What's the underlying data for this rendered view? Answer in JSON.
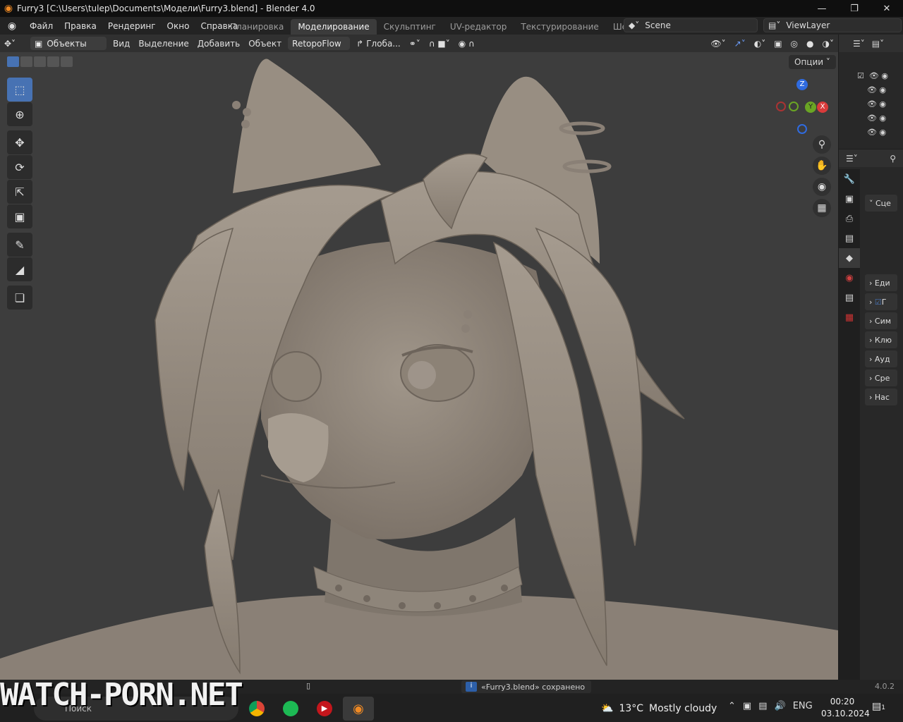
{
  "window": {
    "title": "Furry3 [C:\\Users\\tulep\\Documents\\Модели\\Furry3.blend] - Blender 4.0"
  },
  "menu": [
    "Файл",
    "Правка",
    "Рендеринг",
    "Окно",
    "Справка"
  ],
  "workspaces": [
    "Планировка",
    "Моделирование",
    "Скульптинг",
    "UV-редактор",
    "Текстурирование",
    "Шейдинг"
  ],
  "active_workspace": "Моделирование",
  "scene": {
    "name": "Scene"
  },
  "view_layer": {
    "name": "ViewLayer"
  },
  "viewport_header": {
    "mode": "Объекты",
    "items": [
      "Вид",
      "Выделение",
      "Добавить",
      "Объект"
    ],
    "addon": "RetopoFlow",
    "orientation": "Глоба...",
    "options": "Опции"
  },
  "toolbar_tools": [
    "select-box",
    "cursor",
    "move",
    "rotate",
    "scale",
    "transform",
    "annotate",
    "measure",
    "add-cube"
  ],
  "gizmo": {
    "x": "X",
    "y": "Y",
    "z": "Z"
  },
  "properties_panels": [
    "Сце",
    "Еди",
    "Г",
    "Сим",
    "Клю",
    "Ауд",
    "Сре",
    "Нас"
  ],
  "status": {
    "message": "«Furry3.blend» сохранено",
    "version": "4.0.2"
  },
  "taskbar": {
    "search": "Поиск",
    "weather_temp": "13°C",
    "weather_desc": "Mostly cloudy",
    "lang": "ENG",
    "time": "00:20",
    "date": "03.10.2024",
    "notif_count": "1"
  },
  "watermark": "WATCH-PORN.NET",
  "colors": {
    "accent": "#4772b3",
    "viewport": "#3d3d3d",
    "clay": "#8c8276"
  }
}
